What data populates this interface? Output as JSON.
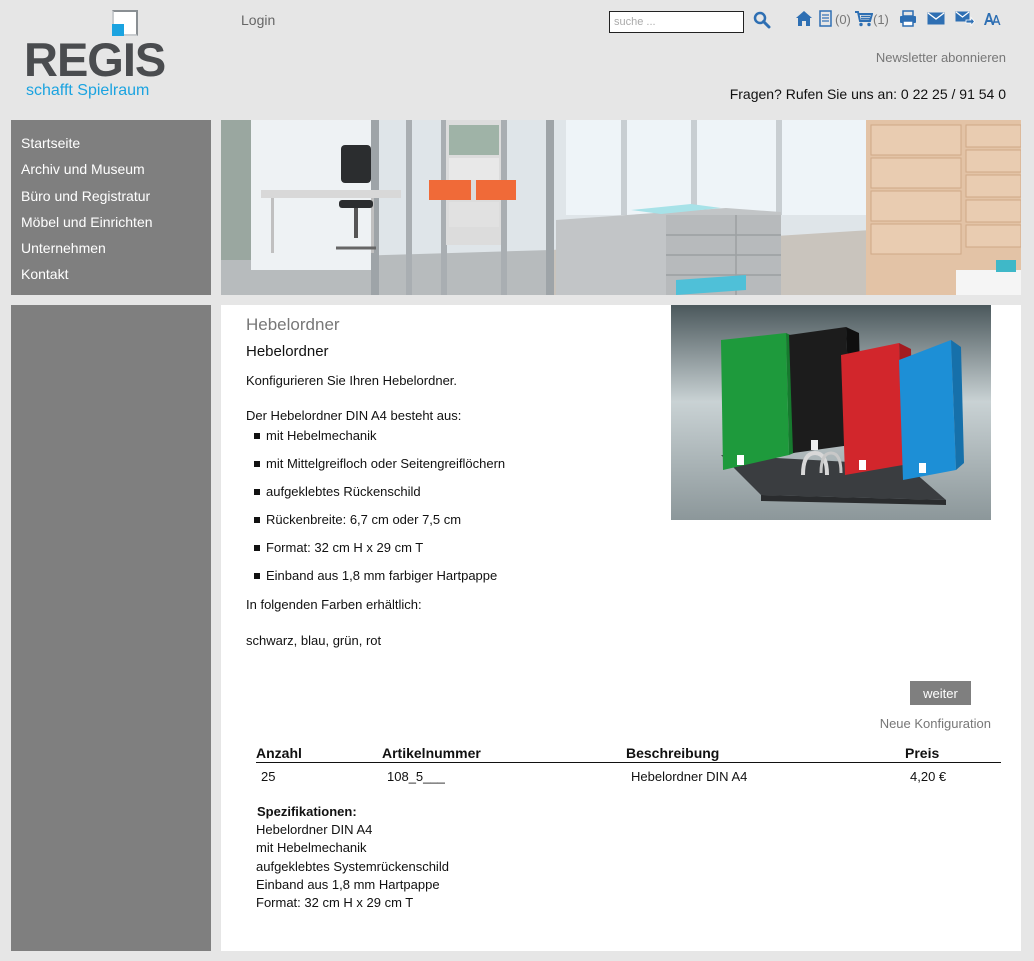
{
  "header": {
    "logo_word": "REGIS",
    "logo_tagline": "schafft Spielraum",
    "login_label": "Login",
    "search_placeholder": "suche ...",
    "notes_count": "(0)",
    "cart_count": "(1)",
    "newsletter_label": "Newsletter abonnieren",
    "phone_text": "Fragen? Rufen Sie uns an: 0 22 25 / 91 54 0"
  },
  "sidebar": {
    "items": [
      {
        "label": "Startseite"
      },
      {
        "label": "Archiv und Museum"
      },
      {
        "label": "Büro und Registratur"
      },
      {
        "label": "Möbel und Einrichten"
      },
      {
        "label": "Unternehmen"
      },
      {
        "label": "Kontakt"
      }
    ]
  },
  "product": {
    "breadcrumb": "Hebelordner",
    "title": "Hebelordner",
    "intro": "Konfigurieren Sie Ihren Hebelordner.",
    "consists_of": "Der Hebelordner DIN A4 besteht aus:",
    "features": [
      "mit Hebelmechanik",
      "mit Mittelgreifloch oder Seitengreiflöchern",
      "aufgeklebtes Rückenschild",
      "Rückenbreite: 6,7 cm oder 7,5 cm",
      "Format: 32 cm H x 29 cm T",
      "Einband aus 1,8 mm farbiger Hartpappe"
    ],
    "colors_label": "In folgenden Farben erhältlich:",
    "colors": "schwarz, blau, grün, rot",
    "next_button": "weiter",
    "new_config_link": "Neue Konfiguration"
  },
  "table": {
    "headers": {
      "qty": "Anzahl",
      "article": "Artikelnummer",
      "desc": "Beschreibung",
      "price": "Preis"
    },
    "rows": [
      {
        "qty": "25",
        "article": "108_5___",
        "desc": "Hebelordner DIN A4",
        "price": "4,20 €"
      }
    ]
  },
  "specs": {
    "heading": "Spezifikationen:",
    "lines": [
      "Hebelordner DIN A4",
      "mit Hebelmechanik",
      "aufgeklebtes Systemrückenschild",
      "Einband aus 1,8 mm Hartpappe",
      "Format: 32 cm H x 29 cm T"
    ]
  },
  "colors": {
    "sidebar_bg": "#7f7f7f",
    "page_bg": "#e6e6e6",
    "icon_blue": "#2e6fb3",
    "brand_blue": "#1ba3e0",
    "binder_green": "#1e9a3c",
    "binder_black": "#1c1c1c",
    "binder_red": "#d2262c",
    "binder_blue": "#1d8fd6"
  },
  "icons": [
    "search-icon",
    "home-icon",
    "notepad-icon",
    "cart-icon",
    "print-icon",
    "mail-icon",
    "forward-mail-icon",
    "font-size-icon"
  ]
}
